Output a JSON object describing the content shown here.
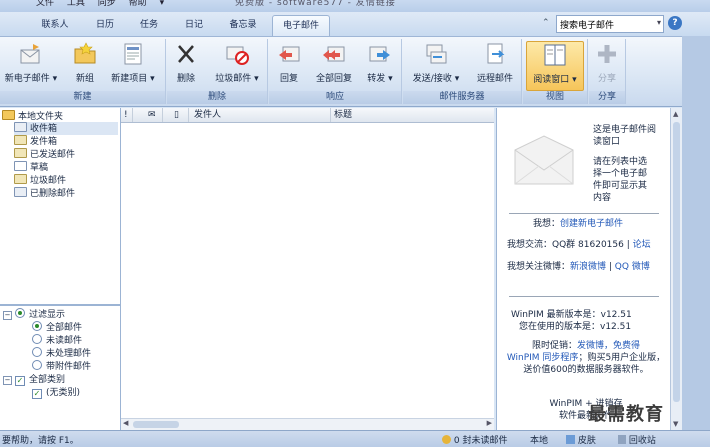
{
  "menu": {
    "file": "文件",
    "tools": "工具",
    "sync": "同步",
    "help": "帮助",
    "more": "▾"
  },
  "window_title": "免费版 - software577 - 友情链接",
  "tabs": [
    {
      "label": "联系人"
    },
    {
      "label": "日历"
    },
    {
      "label": "任务"
    },
    {
      "label": "日记"
    },
    {
      "label": "备忘录"
    },
    {
      "label": "电子邮件",
      "active": true
    }
  ],
  "search": {
    "value": "搜索电子邮件",
    "placeholder": "搜索电子邮件"
  },
  "ribbon": {
    "groups": [
      {
        "title": "新建",
        "buttons": [
          "新电子邮件",
          "新组",
          "新建项目"
        ]
      },
      {
        "title": "删除",
        "buttons": [
          "删除",
          "垃圾邮件"
        ]
      },
      {
        "title": "响应",
        "buttons": [
          "回复",
          "全部回复",
          "转发"
        ]
      },
      {
        "title": "邮件服务器",
        "buttons": [
          "发送/接收",
          "远程邮件"
        ]
      },
      {
        "title": "视图",
        "buttons": [
          "阅读窗口"
        ]
      },
      {
        "title": "分享",
        "buttons": [
          "分享"
        ]
      }
    ]
  },
  "folders": {
    "root": "本地文件夹",
    "items": [
      "收件箱",
      "发件箱",
      "已发送邮件",
      "草稿",
      "垃圾邮件",
      "已删除邮件"
    ]
  },
  "filters": {
    "title": "过滤显示",
    "options": [
      "全部邮件",
      "未读邮件",
      "未处理邮件",
      "带附件邮件"
    ],
    "categories_title": "全部类别",
    "categories": [
      "(无类别)"
    ]
  },
  "columns": {
    "flag": "!",
    "read": "✉",
    "attach": "▯",
    "sender": "发件人",
    "subject": "标题"
  },
  "reading_pane": {
    "intro_title": "这是电子邮件阅读窗口",
    "intro_desc": "请在列表中选择一个电子邮件即可显示其内容",
    "idea_label": "我想：",
    "idea_link": "创建新电子邮件",
    "chat_label": "我想交流：",
    "chat_qq": "QQ群 81620156",
    "chat_sep": "|",
    "chat_forum": "论坛",
    "follow_label": "我想关注微博：",
    "follow_sina": "新浪微博",
    "follow_qq": "QQ 微博",
    "version_latest": "WinPIM 最新版本是：v12.51",
    "version_current": "您在使用的版本是：v12.51",
    "promo_a": "限时促销：",
    "promo_link1": "发微博，免费得",
    "promo_link2": "WinPIM 同步程序",
    "promo_b": "；购买5用户企业版，送价值600的数据服务器软件。",
    "bottom_line1": "WinPIM + 进销存",
    "bottom_line2": "软件最新力作"
  },
  "status": {
    "left": "要帮助，请按 F1。",
    "unread": "0 封未读邮件",
    "local": "本地",
    "skin": "皮肤",
    "recycle": "回收站"
  },
  "watermark": "最需教育",
  "colors": {
    "accent": "#3b77c4",
    "selection": "#dbe6f4",
    "ribbon_title": "#b9cce6"
  }
}
